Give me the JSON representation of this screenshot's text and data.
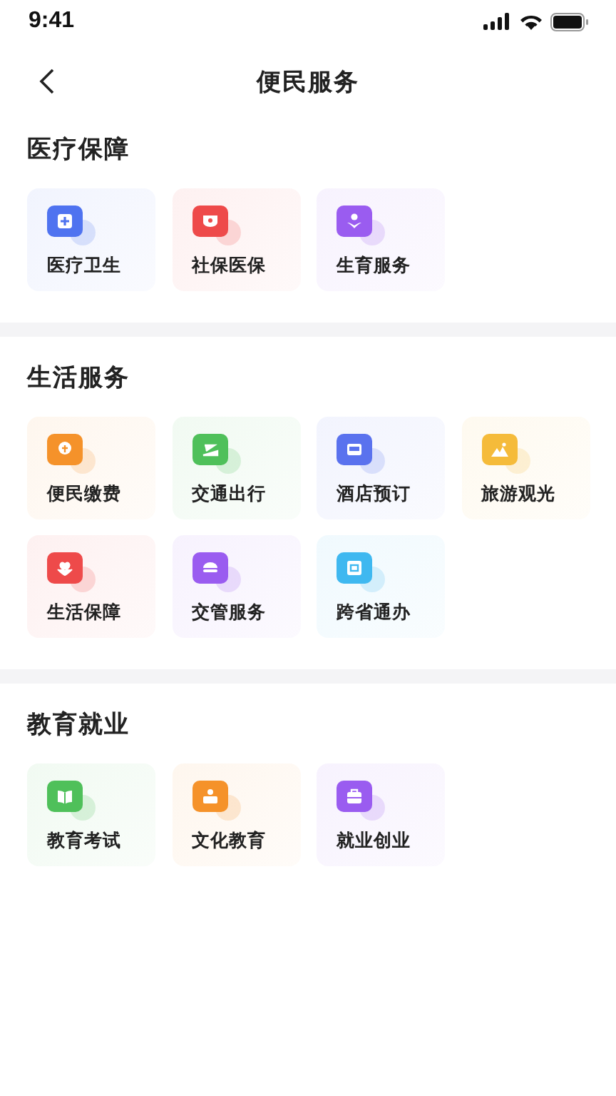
{
  "status_bar": {
    "time": "9:41"
  },
  "nav": {
    "title": "便民服务"
  },
  "sections": [
    {
      "title": "医疗保障",
      "items": [
        {
          "label": "医疗卫生",
          "color": "#4f73f0"
        },
        {
          "label": "社保医保",
          "color": "#ee4a4a"
        },
        {
          "label": "生育服务",
          "color": "#9a5cf0"
        }
      ]
    },
    {
      "title": "生活服务",
      "items": [
        {
          "label": "便民缴费",
          "color": "#f5922a"
        },
        {
          "label": "交通出行",
          "color": "#4fc05a"
        },
        {
          "label": "酒店预订",
          "color": "#5a72ee"
        },
        {
          "label": "旅游观光",
          "color": "#f5bb3a"
        },
        {
          "label": "生活保障",
          "color": "#ee4a4a"
        },
        {
          "label": "交管服务",
          "color": "#9a5cf0"
        },
        {
          "label": "跨省通办",
          "color": "#3fb8f0"
        }
      ]
    },
    {
      "title": "教育就业",
      "items": [
        {
          "label": "教育考试",
          "color": "#4fc05a"
        },
        {
          "label": "文化教育",
          "color": "#f5922a"
        },
        {
          "label": "就业创业",
          "color": "#9a5cf0"
        }
      ]
    }
  ]
}
